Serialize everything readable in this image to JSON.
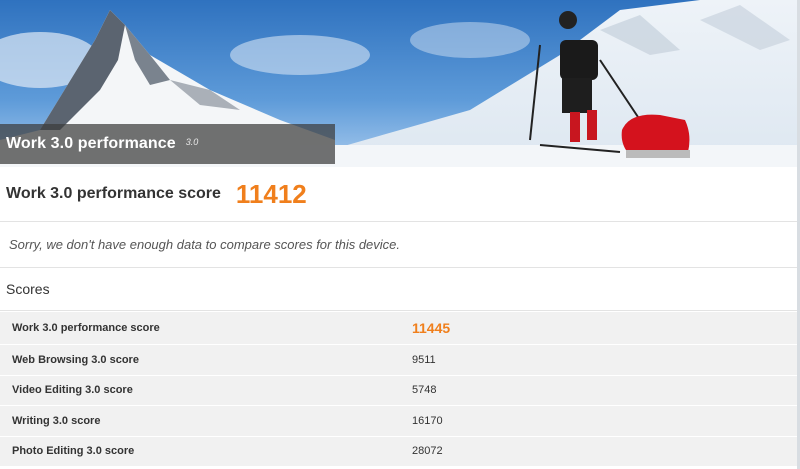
{
  "hero": {
    "title": "Work 3.0 performance",
    "version": "3.0"
  },
  "score_header": {
    "label": "Work 3.0 performance score",
    "value": "11412"
  },
  "compare_message": "Sorry, we don't have enough data to compare scores for this device.",
  "scores_section": {
    "heading": "Scores",
    "rows": [
      {
        "name": "Work 3.0 performance score",
        "value": "11445"
      },
      {
        "name": "Web Browsing 3.0 score",
        "value": "9511"
      },
      {
        "name": "Video Editing 3.0 score",
        "value": "5748"
      },
      {
        "name": "Writing 3.0 score",
        "value": "16170"
      },
      {
        "name": "Photo Editing 3.0 score",
        "value": "28072"
      }
    ]
  },
  "colors": {
    "accent": "#f07f1c",
    "row_bg": "#f1f1f1",
    "title_bar": "#3c3c3c"
  }
}
